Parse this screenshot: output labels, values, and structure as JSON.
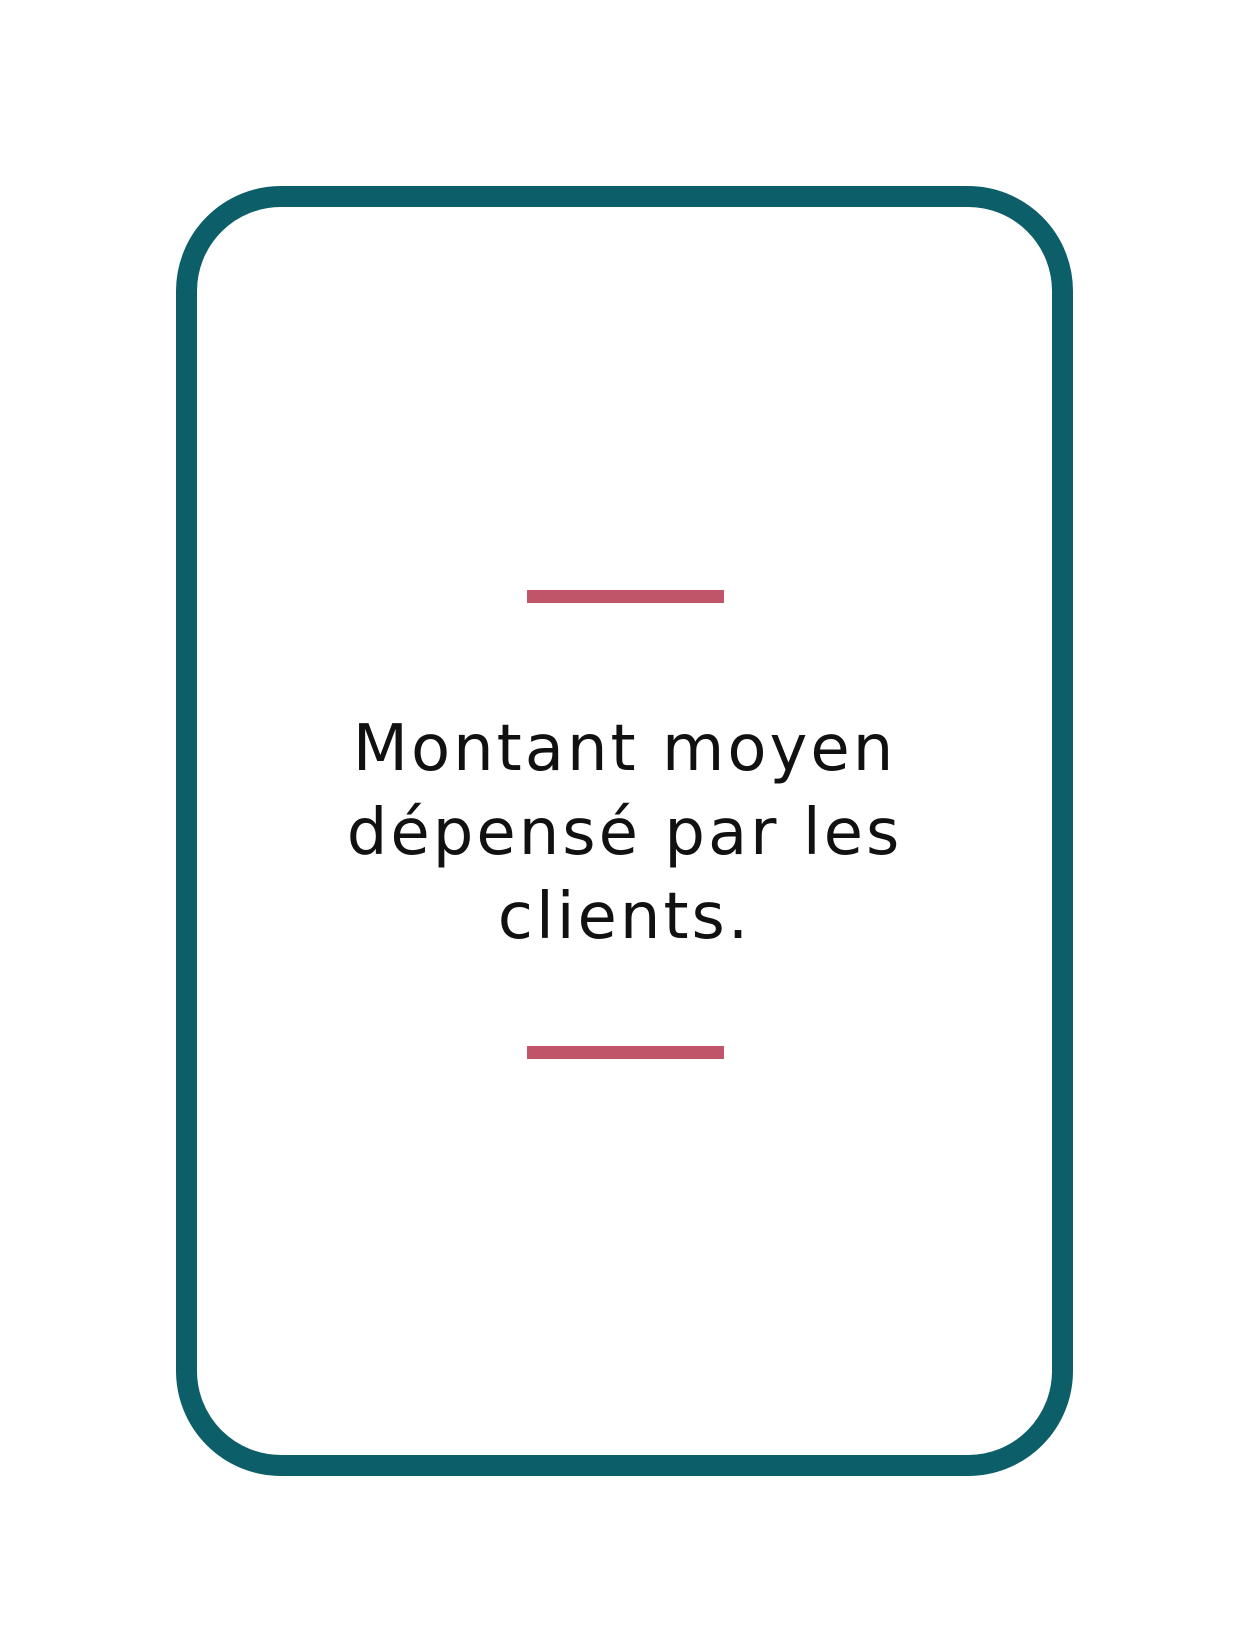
{
  "card": {
    "text_lines": [
      "Montant moyen",
      "dépensé par les",
      "clients."
    ]
  },
  "colors": {
    "frame": "#0c5e68",
    "accent_rule": "#c05469",
    "text": "#111111",
    "background": "#ffffff"
  }
}
